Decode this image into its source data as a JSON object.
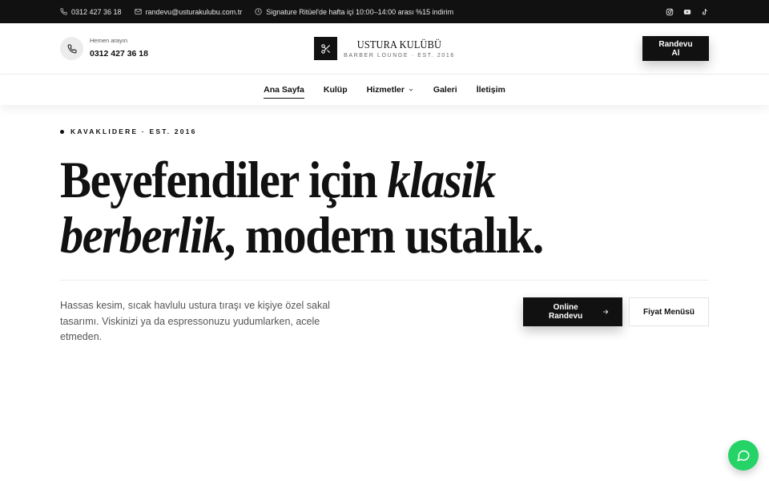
{
  "topbar": {
    "phone": "0312 427 36 18",
    "email": "randevu@usturakulubu.com.tr",
    "promo": "Signature Ritüel'de hafta içi 10:00–14:00 arası %15 indirim",
    "socials": [
      "instagram-icon",
      "youtube-icon",
      "tiktok-icon"
    ]
  },
  "header": {
    "call_label": "Hemen arayın",
    "call_number": "0312 427 36 18",
    "brand_name": "USTURA KULÜBÜ",
    "brand_tagline": "BARBER LOUNGE · EST. 2016",
    "cta_label": "Randevu Al"
  },
  "nav": {
    "items": [
      {
        "label": "Ana Sayfa",
        "active": true
      },
      {
        "label": "Kulüp"
      },
      {
        "label": "Hizmetler",
        "dropdown": true
      },
      {
        "label": "Galeri"
      },
      {
        "label": "İletişim"
      }
    ]
  },
  "hero": {
    "eyebrow": "KAVAKLIDERE · EST. 2016",
    "headline_1": "Beyefendiler için ",
    "headline_1_em": "klasik",
    "headline_2_em": "berberlik",
    "headline_2": ", modern ustalık.",
    "description": "Hassas kesim, sıcak havlulu ustura tıraşı ve kişiye özel sakal tasarımı. Viskinizi ya da espressonuzu yudumlarken, acele etmeden.",
    "primary_cta": "Online Randevu",
    "secondary_cta": "Fiyat Menüsü"
  },
  "colors": {
    "dark": "#111111",
    "chat": "#25d366"
  }
}
